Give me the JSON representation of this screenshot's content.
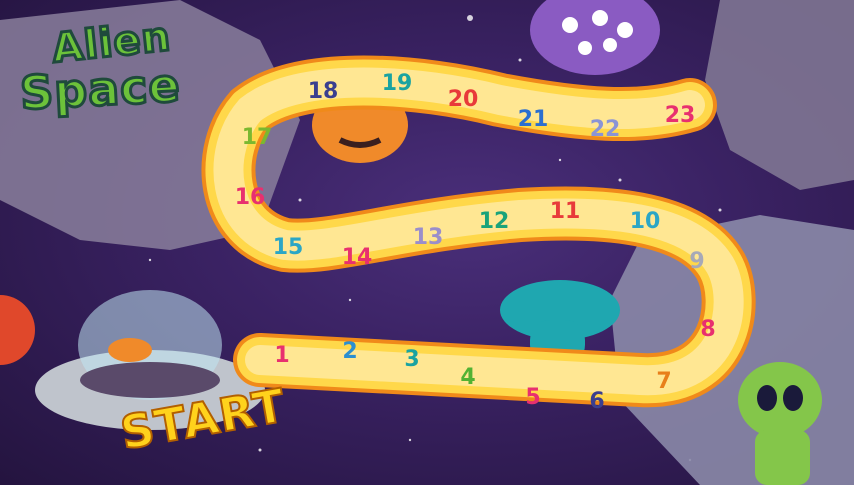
{
  "game": {
    "title_line1": "Alien",
    "title_line2": "Space",
    "start_label": "START",
    "squares": [
      {
        "n": "1",
        "color": "#e8306f"
      },
      {
        "n": "2",
        "color": "#2b8fd0"
      },
      {
        "n": "3",
        "color": "#1aa3a1"
      },
      {
        "n": "4",
        "color": "#52b233"
      },
      {
        "n": "5",
        "color": "#e8306f"
      },
      {
        "n": "6",
        "color": "#3a3f8f"
      },
      {
        "n": "7",
        "color": "#e87f1a"
      },
      {
        "n": "8",
        "color": "#e8306f"
      },
      {
        "n": "9",
        "color": "#a7a9b8"
      },
      {
        "n": "10",
        "color": "#2ba6c6"
      },
      {
        "n": "11",
        "color": "#e83a3a"
      },
      {
        "n": "12",
        "color": "#1aa37a"
      },
      {
        "n": "13",
        "color": "#9a8ecb"
      },
      {
        "n": "14",
        "color": "#e8306f"
      },
      {
        "n": "15",
        "color": "#2ba6c6"
      },
      {
        "n": "16",
        "color": "#e8306f"
      },
      {
        "n": "17",
        "color": "#7bb82f"
      },
      {
        "n": "18",
        "color": "#3a3f8f"
      },
      {
        "n": "19",
        "color": "#1aa3a1"
      },
      {
        "n": "20",
        "color": "#e83a3a"
      },
      {
        "n": "21",
        "color": "#2b6fd0"
      },
      {
        "n": "22",
        "color": "#8a94d6"
      },
      {
        "n": "23",
        "color": "#e8306f"
      }
    ]
  },
  "colors": {
    "path_fill": "#ffd84a",
    "path_edge": "#f08a1a",
    "path_inner": "#fff2c4"
  }
}
